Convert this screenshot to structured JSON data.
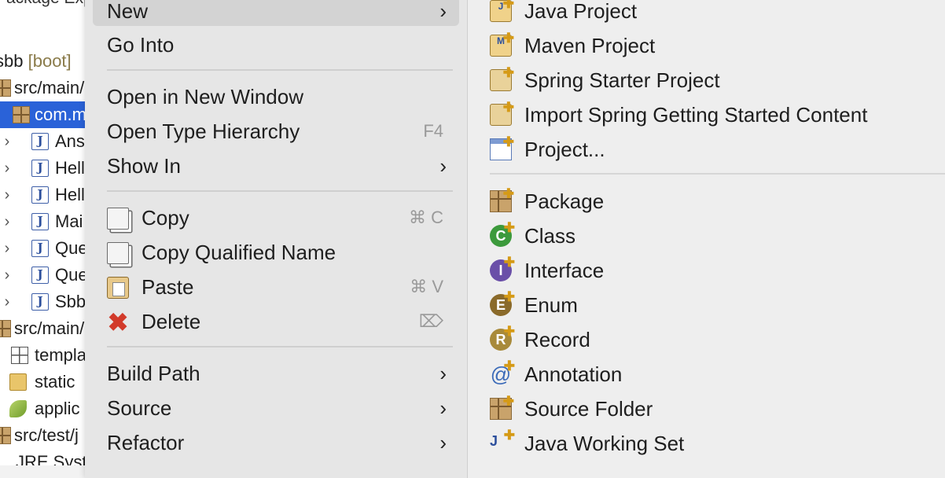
{
  "explorer": {
    "title": "Package Explo",
    "rows": [
      {
        "label": "sbb",
        "suffix": "[boot]"
      },
      {
        "label": "src/main/"
      },
      {
        "label": "com.m"
      },
      {
        "label": "Ans"
      },
      {
        "label": "Hell"
      },
      {
        "label": "Hell"
      },
      {
        "label": "Mai"
      },
      {
        "label": "Que"
      },
      {
        "label": "Que"
      },
      {
        "label": "Sbb"
      },
      {
        "label": "src/main/"
      },
      {
        "label": "templa"
      },
      {
        "label": "static"
      },
      {
        "label": "applic"
      },
      {
        "label": "src/test/j"
      },
      {
        "label": "JRE Syst"
      }
    ]
  },
  "menu": {
    "items": [
      {
        "label": "New"
      },
      {
        "label": "Go Into"
      },
      {
        "label": "Open in New Window"
      },
      {
        "label": "Open Type Hierarchy",
        "shortcut": "F4"
      },
      {
        "label": "Show In"
      },
      {
        "label": "Copy",
        "shortcut": "⌘ C"
      },
      {
        "label": "Copy Qualified Name"
      },
      {
        "label": "Paste",
        "shortcut": "⌘ V"
      },
      {
        "label": "Delete",
        "shortcut": "⌦"
      },
      {
        "label": "Build Path"
      },
      {
        "label": "Source"
      },
      {
        "label": "Refactor"
      }
    ],
    "submenu_arrow": "›"
  },
  "submenu": {
    "items": [
      {
        "label": "Java Project",
        "icon": "java-project-icon"
      },
      {
        "label": "Maven Project",
        "icon": "maven-project-icon"
      },
      {
        "label": "Spring Starter Project",
        "icon": "spring-starter-icon"
      },
      {
        "label": "Import Spring Getting Started Content",
        "icon": "spring-import-icon"
      },
      {
        "label": "Project...",
        "icon": "project-icon"
      },
      {
        "label": "Package",
        "icon": "package-icon"
      },
      {
        "label": "Class",
        "icon": "class-icon"
      },
      {
        "label": "Interface",
        "icon": "interface-icon"
      },
      {
        "label": "Enum",
        "icon": "enum-icon"
      },
      {
        "label": "Record",
        "icon": "record-icon"
      },
      {
        "label": "Annotation",
        "icon": "annotation-icon"
      },
      {
        "label": "Source Folder",
        "icon": "source-folder-icon"
      },
      {
        "label": "Java Working Set",
        "icon": "working-set-icon"
      }
    ]
  },
  "colors": {
    "selection": "#2a62d8",
    "class": "#3c9a3c",
    "interface": "#6a4fa8",
    "enum": "#8a6a2a",
    "record": "#a88a3a",
    "annotation": "#3a6ab8"
  }
}
